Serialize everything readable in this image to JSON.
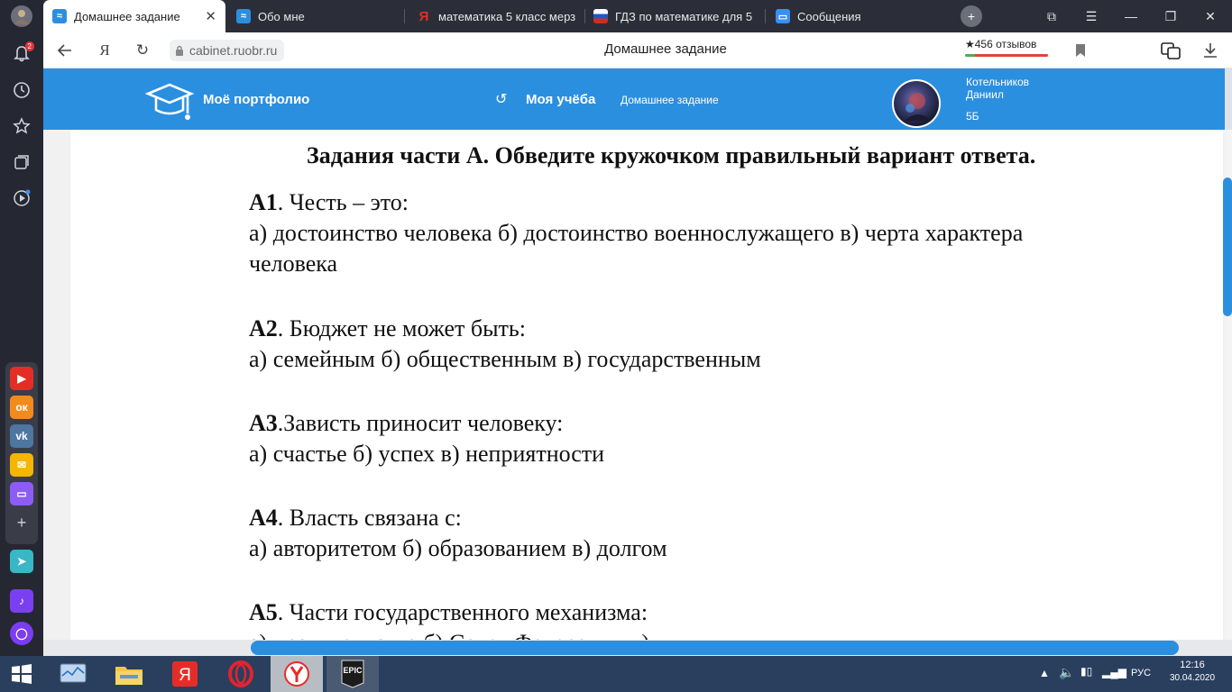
{
  "tabs": [
    {
      "title": "Домашнее задание",
      "active": true
    },
    {
      "title": "Обо мне",
      "active": false
    },
    {
      "title": "математика 5 класс мерз",
      "active": false
    },
    {
      "title": "ГДЗ по математике для 5",
      "active": false
    },
    {
      "title": "Сообщения",
      "active": false
    }
  ],
  "sidebar": {
    "notifications_count": "2"
  },
  "address_bar": {
    "url": "cabinet.ruobr.ru",
    "page_title": "Домашнее задание",
    "reviews": "★456 отзывов"
  },
  "site_header": {
    "portfolio": "Моё портфолио",
    "study": "Моя учёба",
    "homework": "Домашнее задание",
    "user_name_line1": "Котельников",
    "user_name_line2": "Даниил",
    "user_class": "5Б"
  },
  "document": {
    "heading": "Задания части А. Обведите кружочком правильный вариант ответа.",
    "questions": [
      {
        "num": "А1",
        "sep": ". ",
        "text": "Честь – это:",
        "answers": "а) достоинство  человека   б) достоинство  военнослужащего   в) черта характера",
        "answers_cont": "человека"
      },
      {
        "num": "А2",
        "sep": ". ",
        "text": "Бюджет не может быть:",
        "answers": "а) семейным   б) общественным   в) государственным"
      },
      {
        "num": "А3",
        "sep": ".",
        "text": "Зависть приносит человеку:",
        "answers": "а) счастье   б) успех  в) неприятности"
      },
      {
        "num": "А4",
        "sep": ". ",
        "text": "Власть связана с:",
        "answers": "а) авторитетом   б) образованием   в) долгом"
      },
      {
        "num": "А5",
        "sep": ". ",
        "text": "Части государственного  механизма:",
        "answers": "а) правительство   б) Совет Федерации   в)"
      }
    ]
  },
  "taskbar": {
    "language": "РУС",
    "time": "12:16",
    "date": "30.04.2020",
    "epic_label": "EPIC"
  },
  "colors": {
    "brand": "#2b8fe0",
    "sidebar_bg": "#252833",
    "taskbar_bg": "#2a3f5e"
  }
}
